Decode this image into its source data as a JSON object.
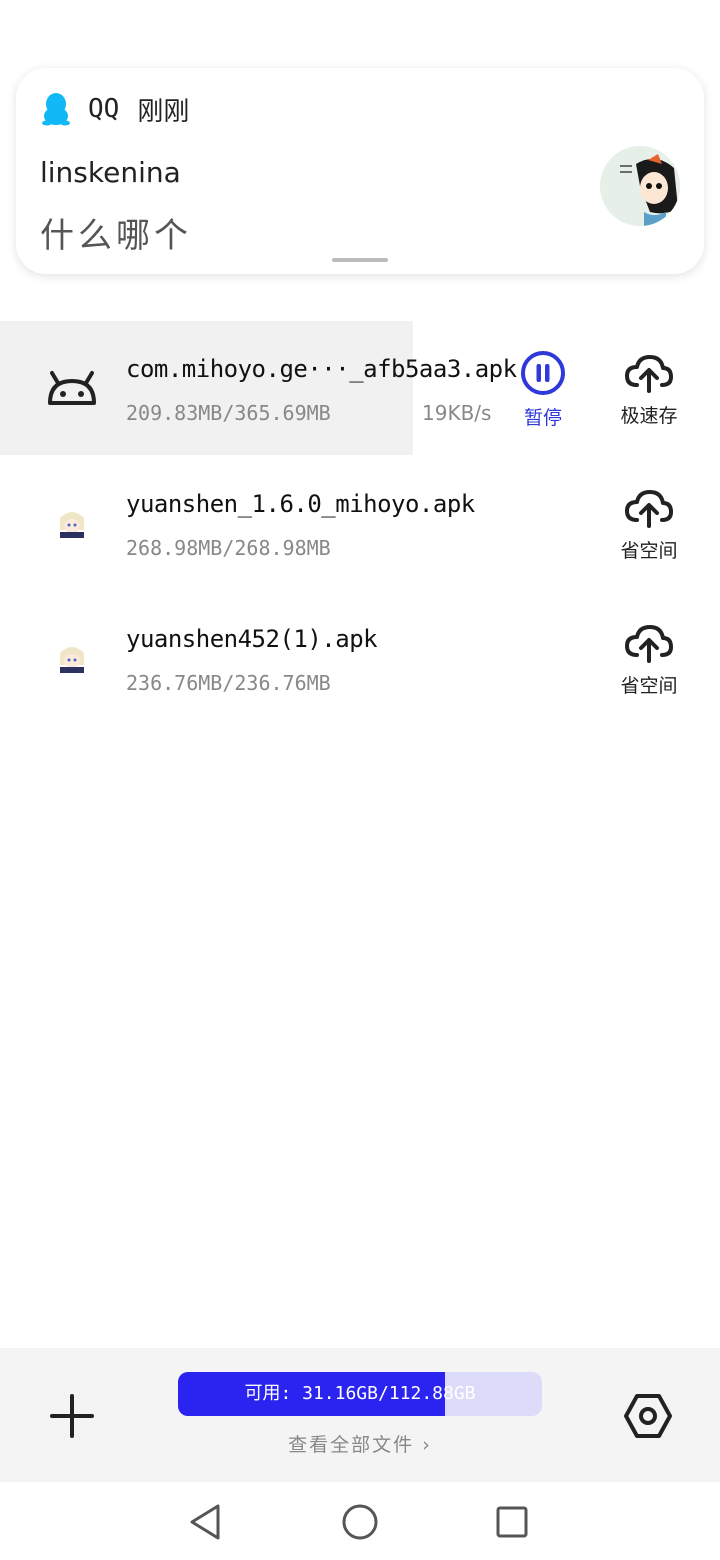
{
  "notification": {
    "app_name": "QQ",
    "time": "刚刚",
    "sender": "linskenina",
    "message": "什么哪个"
  },
  "files": [
    {
      "name": "com.mihoyo.ge···_afb5aa3.apk",
      "size": "209.83MB/365.69MB",
      "speed": "19KB/s",
      "progress": 0.574,
      "icon": "android-icon",
      "actions": {
        "pause_label": "暂停",
        "cloud_label": "极速存"
      }
    },
    {
      "name": "yuanshen_1.6.0_mihoyo.apk",
      "size": "268.98MB/268.98MB",
      "icon": "game-avatar-icon",
      "actions": {
        "cloud_label": "省空间"
      }
    },
    {
      "name": "yuanshen452(1).apk",
      "size": "236.76MB/236.76MB",
      "icon": "game-avatar-icon",
      "actions": {
        "cloud_label": "省空间"
      }
    }
  ],
  "storage": {
    "label": "可用: 31.16GB/112.88GB",
    "used_fraction": 0.734
  },
  "view_all": "查看全部文件 ›",
  "colors": {
    "accent": "#2b24f0",
    "pause": "#2f38d8",
    "qq_blue": "#12b7f5"
  }
}
